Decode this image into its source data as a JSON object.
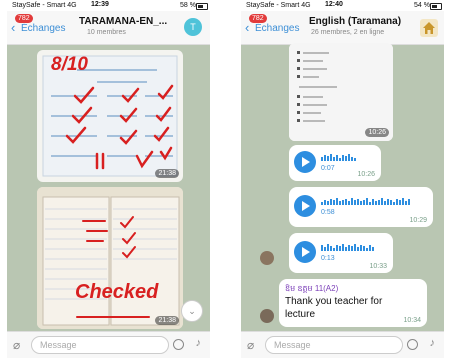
{
  "left": {
    "status": {
      "carrier": "StaySafe - Smart 4G",
      "time": "12:39",
      "battery": "58 %"
    },
    "header": {
      "badge": "782",
      "back": "Échanges",
      "title": "TARAMANA-EN_...",
      "subtitle": "10 membres",
      "avatar": "T"
    },
    "photo1": {
      "score": "8/10",
      "time": "21:38"
    },
    "photo2": {
      "word": "Checked",
      "time": "21:38"
    },
    "input": {
      "placeholder": "Message"
    }
  },
  "right": {
    "status": {
      "carrier": "StaySafe - Smart 4G",
      "time": "12:40",
      "battery": "54 %"
    },
    "header": {
      "badge": "782",
      "back": "Échanges",
      "title": "English (Taramana)",
      "subtitle": "26 membres, 2 en ligne"
    },
    "photo": {
      "time": "10:26"
    },
    "voice": [
      {
        "duration": "0:07",
        "time": "10:26"
      },
      {
        "duration": "0:58",
        "time": "10:29"
      },
      {
        "duration": "0:13",
        "time": "10:33"
      }
    ],
    "text_msg": {
      "sender": "ឱម ឧត្តម 11(A2)",
      "text": "Thank you teacher for lecture",
      "time": "10:34"
    },
    "input": {
      "placeholder": "Message"
    }
  },
  "colors": {
    "accent": "#2d8ee0",
    "chat_bg": "#b9c6b2",
    "badge": "#e23b3b"
  }
}
